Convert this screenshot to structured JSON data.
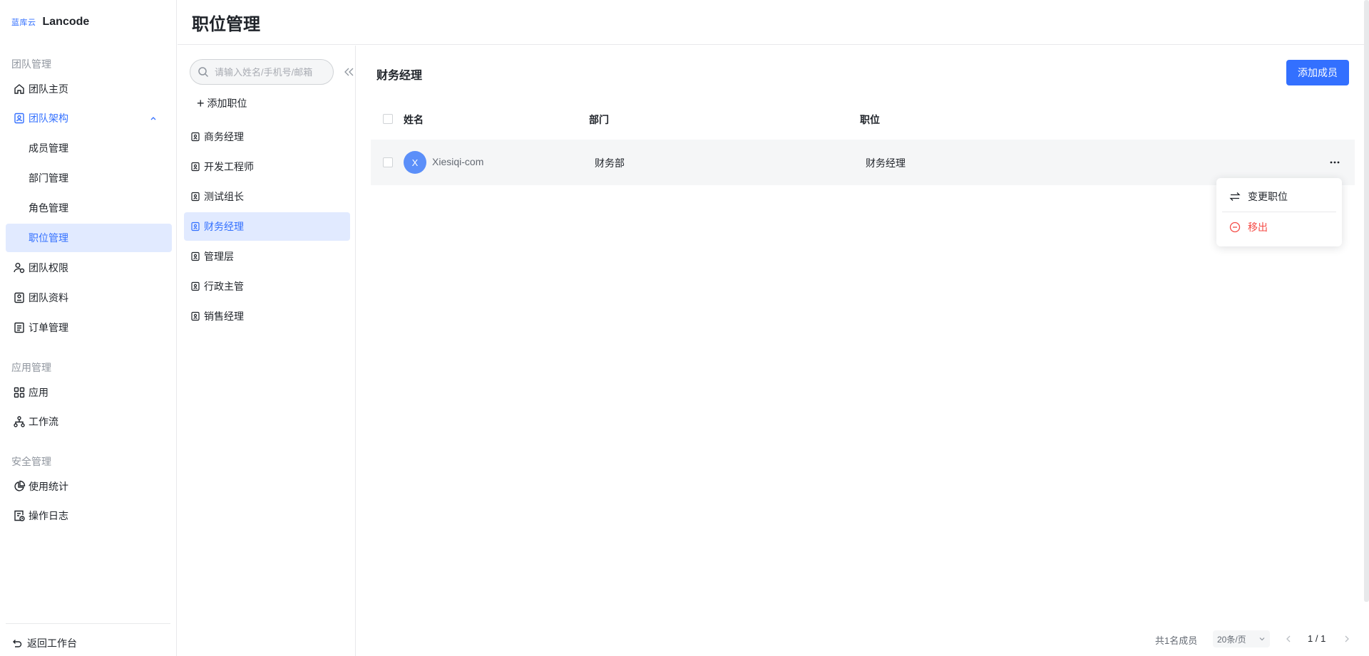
{
  "sidebar": {
    "logo_mark": "蓝库云",
    "logo_text": "Lancode",
    "groups": {
      "team": "团队管理",
      "app": "应用管理",
      "security": "安全管理"
    },
    "items": {
      "home": "团队主页",
      "structure": "团队架构",
      "members": "成员管理",
      "departments": "部门管理",
      "roles": "角色管理",
      "positions": "职位管理",
      "permissions": "团队权限",
      "profile": "团队资料",
      "orders": "订单管理",
      "apps": "应用",
      "workflow": "工作流",
      "stats": "使用统计",
      "logs": "操作日志"
    },
    "back": "返回工作台"
  },
  "header": {
    "title": "职位管理"
  },
  "positions_panel": {
    "search_placeholder": "请输入姓名/手机号/邮箱",
    "add_label": "添加职位",
    "items": [
      "商务经理",
      "开发工程师",
      "测试组长",
      "财务经理",
      "管理层",
      "行政主管",
      "销售经理"
    ],
    "active": "财务经理"
  },
  "main": {
    "title": "财务经理",
    "add_member_label": "添加成员",
    "columns": [
      "姓名",
      "部门",
      "职位"
    ],
    "rows": [
      {
        "avatar": "X",
        "name": "Xiesiqi-com",
        "department": "财务部",
        "position": "财务经理"
      }
    ]
  },
  "dropdown": {
    "change": "变更职位",
    "remove": "移出"
  },
  "pagination": {
    "total": "共1名成员",
    "page_size": "20条/页",
    "page": "1 / 1"
  },
  "colors": {
    "accent": "#3370ff",
    "active_bg": "#e1eaff",
    "danger": "#f54a45",
    "avatar": "#5b8ff9"
  }
}
